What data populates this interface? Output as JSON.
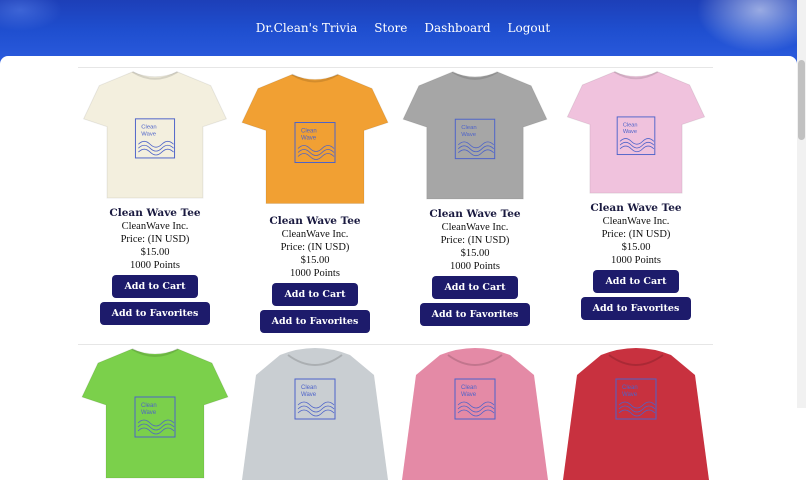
{
  "nav": {
    "items": [
      "Dr.Clean's Trivia",
      "Store",
      "Dashboard",
      "Logout"
    ]
  },
  "products": [
    {
      "title": "Clean Wave Tee",
      "brand": "CleanWave Inc.",
      "price_label": "Price: (IN USD)",
      "price": "$15.00",
      "points": "1000 Points",
      "color": "#f3efde",
      "kind": "tee"
    },
    {
      "title": "Clean Wave Tee",
      "brand": "CleanWave Inc.",
      "price_label": "Price: (IN USD)",
      "price": "$15.00",
      "points": "1000 Points",
      "color": "#f1a033",
      "kind": "tee"
    },
    {
      "title": "Clean Wave Tee",
      "brand": "CleanWave Inc.",
      "price_label": "Price: (IN USD)",
      "price": "$15.00",
      "points": "1000 Points",
      "color": "#a6a6a6",
      "kind": "tee"
    },
    {
      "title": "Clean Wave Tee",
      "brand": "CleanWave Inc.",
      "price_label": "Price: (IN USD)",
      "price": "$15.00",
      "points": "1000 Points",
      "color": "#f0c2dd",
      "kind": "tee"
    }
  ],
  "second_row": [
    {
      "color": "#7bd04b",
      "kind": "tee"
    },
    {
      "color": "#c9ced2",
      "kind": "hoodie"
    },
    {
      "color": "#e48aa6",
      "kind": "hoodie"
    },
    {
      "color": "#c8313f",
      "kind": "hoodie"
    }
  ],
  "logo_text": [
    "Clean",
    "Wave"
  ],
  "buttons": {
    "cart": "Add to Cart",
    "favorites": "Add to Favorites"
  }
}
